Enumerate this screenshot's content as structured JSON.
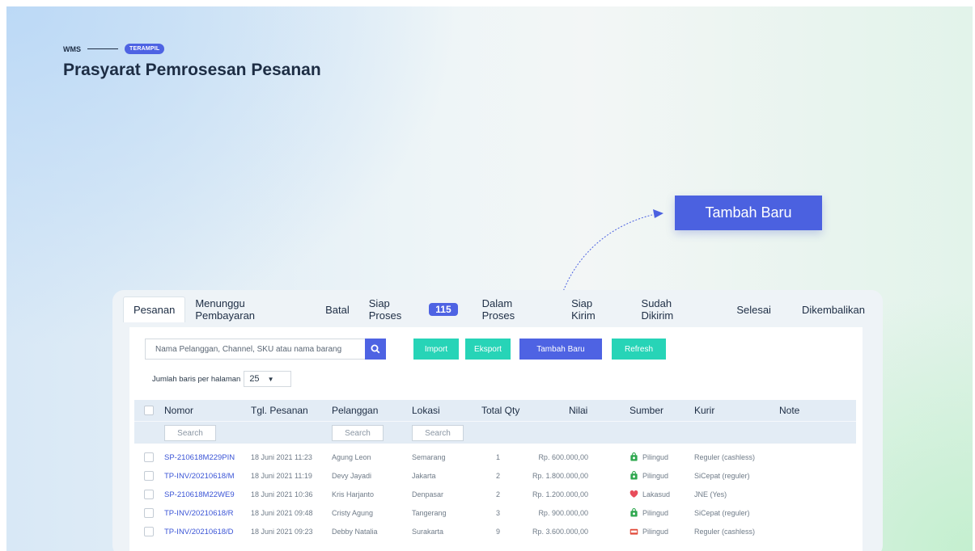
{
  "header": {
    "breadcrumb": "WMS",
    "badge": "TERAMPIL",
    "title": "Prasyarat Pemrosesan Pesanan"
  },
  "callout": {
    "label": "Tambah Baru"
  },
  "tabs": [
    {
      "label": "Pesanan"
    },
    {
      "label": "Menunggu Pembayaran"
    },
    {
      "label": "Batal"
    },
    {
      "label": "Siap Proses",
      "count": "115"
    },
    {
      "label": "Dalam Proses"
    },
    {
      "label": "Siap Kirim"
    },
    {
      "label": "Sudah Dikirim"
    },
    {
      "label": "Selesai"
    },
    {
      "label": "Dikembalikan"
    }
  ],
  "toolbar": {
    "search_placeholder": "Nama Pelanggan, Channel, SKU atau nama barang",
    "import": "Import",
    "export": "Eksport",
    "add": "Tambah Baru",
    "refresh": "Refresh"
  },
  "pagination": {
    "label": "Jumlah baris per halaman",
    "value": "25"
  },
  "table": {
    "columns": [
      "Nomor",
      "Tgl. Pesanan",
      "Pelanggan",
      "Lokasi",
      "Total Qty",
      "Nilai",
      "Sumber",
      "Kurir",
      "Note"
    ],
    "filter_placeholder": "Search",
    "rows": [
      {
        "order": "SP-210618M229PIN",
        "date": "18 Juni 2021 11:23",
        "customer": "Agung Leon",
        "location": "Semarang",
        "qty": "1",
        "value": "Rp. 600.000,00",
        "source": "Pilingud",
        "source_icon": "green-bag-icon",
        "courier": "Reguler (cashless)"
      },
      {
        "order": "TP-INV/20210618/M",
        "date": "18 Juni 2021 11:19",
        "customer": "Devy Jayadi",
        "location": "Jakarta",
        "qty": "2",
        "value": "Rp. 1.800.000,00",
        "source": "Pilingud",
        "source_icon": "green-bag-icon",
        "courier": "SiCepat (reguler)"
      },
      {
        "order": "SP-210618M22WE9",
        "date": "18 Juni 2021 10:36",
        "customer": "Kris Harjanto",
        "location": "Denpasar",
        "qty": "2",
        "value": "Rp. 1.200.000,00",
        "source": "Lakasud",
        "source_icon": "heart-icon",
        "courier": "JNE (Yes)"
      },
      {
        "order": "TP-INV/20210618/R",
        "date": "18 Juni 2021 09:48",
        "customer": "Cristy Agung",
        "location": "Tangerang",
        "qty": "3",
        "value": "Rp. 900.000,00",
        "source": "Pilingud",
        "source_icon": "green-bag-icon",
        "courier": "SiCepat (reguler)"
      },
      {
        "order": "TP-INV/20210618/D",
        "date": "18 Juni 2021 09:23",
        "customer": "Debby Natalia",
        "location": "Surakarta",
        "qty": "9",
        "value": "Rp. 3.600.000,00",
        "source": "Pilingud",
        "source_icon": "store-icon",
        "courier": "Reguler (cashless)"
      }
    ]
  },
  "colors": {
    "primary": "#4e63e3",
    "teal": "#27d4b7",
    "link": "#3b55d6",
    "heading": "#1d2d44"
  }
}
